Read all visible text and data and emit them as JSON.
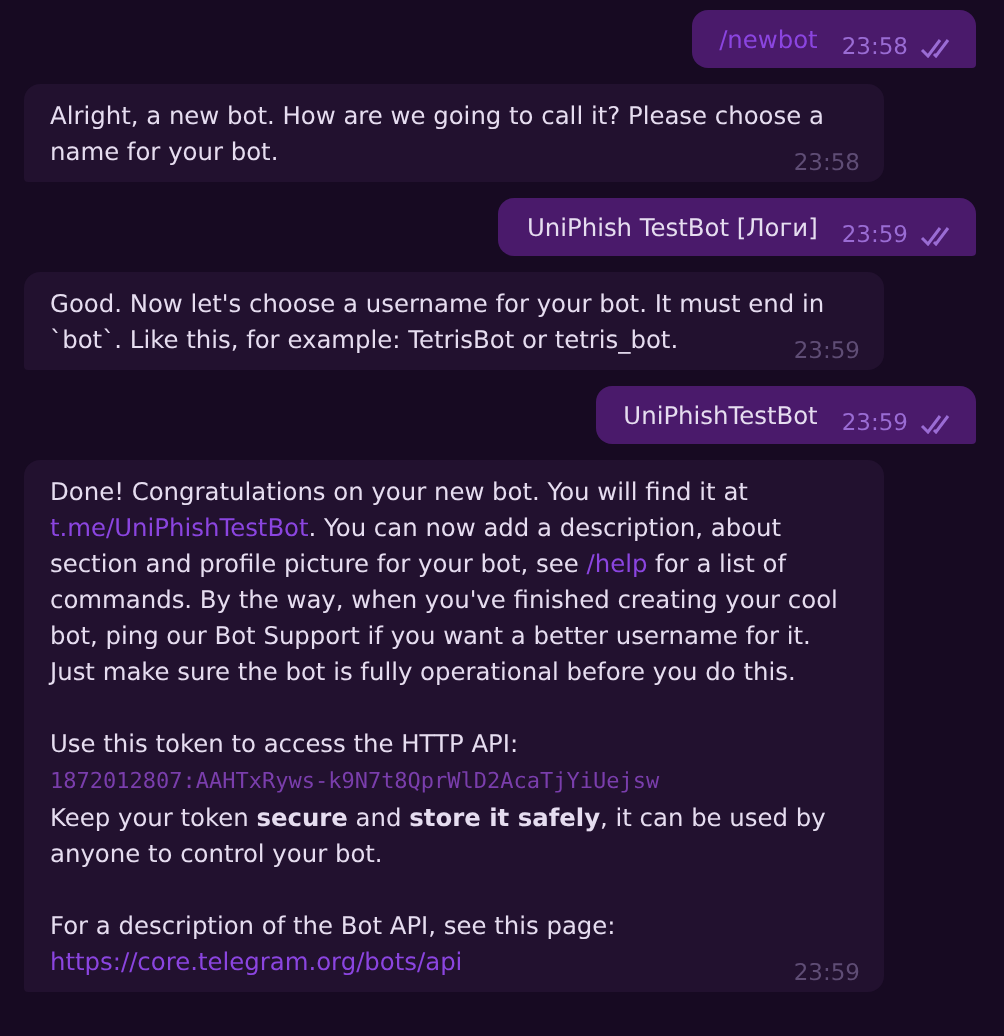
{
  "messages": [
    {
      "kind": "outgoing",
      "paragraphs": [
        [
          [
            {
              "kind": "link",
              "text": "/newbot"
            }
          ]
        ]
      ],
      "time": "23:58",
      "read": true
    },
    {
      "kind": "incoming",
      "paragraphs": [
        [
          [
            {
              "kind": "text",
              "text": "Alright, a new bot. How are we going to call it? Please choose a name for your bot."
            }
          ]
        ]
      ],
      "time": "23:58"
    },
    {
      "kind": "outgoing",
      "paragraphs": [
        [
          [
            {
              "kind": "text",
              "text": "UniPhish TestBot [Логи]"
            }
          ]
        ]
      ],
      "time": "23:59",
      "read": true
    },
    {
      "kind": "incoming",
      "paragraphs": [
        [
          [
            {
              "kind": "text",
              "text": "Good. Now let's choose a username for your bot. It must end in `bot`. Like this, for example: TetrisBot or tetris_bot."
            }
          ]
        ]
      ],
      "time": "23:59"
    },
    {
      "kind": "outgoing",
      "paragraphs": [
        [
          [
            {
              "kind": "text",
              "text": "UniPhishTestBot"
            }
          ]
        ]
      ],
      "time": "23:59",
      "read": true
    },
    {
      "kind": "incoming",
      "paragraphs": [
        [
          [
            {
              "kind": "text",
              "text": "Done! Congratulations on your new bot. You will find it at "
            },
            {
              "kind": "link",
              "text": "t.me/UniPhishTestBot"
            },
            {
              "kind": "text",
              "text": ". You can now add a description, about section and profile picture for your bot, see "
            },
            {
              "kind": "link",
              "text": "/help"
            },
            {
              "kind": "text",
              "text": " for a list of commands. By the way, when you've finished creating your cool bot, ping our Bot Support if you want a better username for it. Just make sure the bot is fully operational before you do this."
            }
          ]
        ],
        [
          [
            {
              "kind": "text",
              "text": "Use this token to access the HTTP API:"
            }
          ],
          [
            {
              "kind": "code",
              "text": "1872012807:AAHTxRyws-k9N7t8QprWlD2AcaTjYiUejsw"
            }
          ],
          [
            {
              "kind": "text",
              "text": "Keep your token **secure** and **store it safely**, it can be used by anyone to control your bot."
            }
          ]
        ],
        [
          [
            {
              "kind": "text",
              "text": "For a description of the Bot API, see this page:"
            }
          ],
          [
            {
              "kind": "link",
              "text": "https://core.telegram.org/bots/api"
            }
          ]
        ]
      ],
      "time": "23:59"
    }
  ]
}
